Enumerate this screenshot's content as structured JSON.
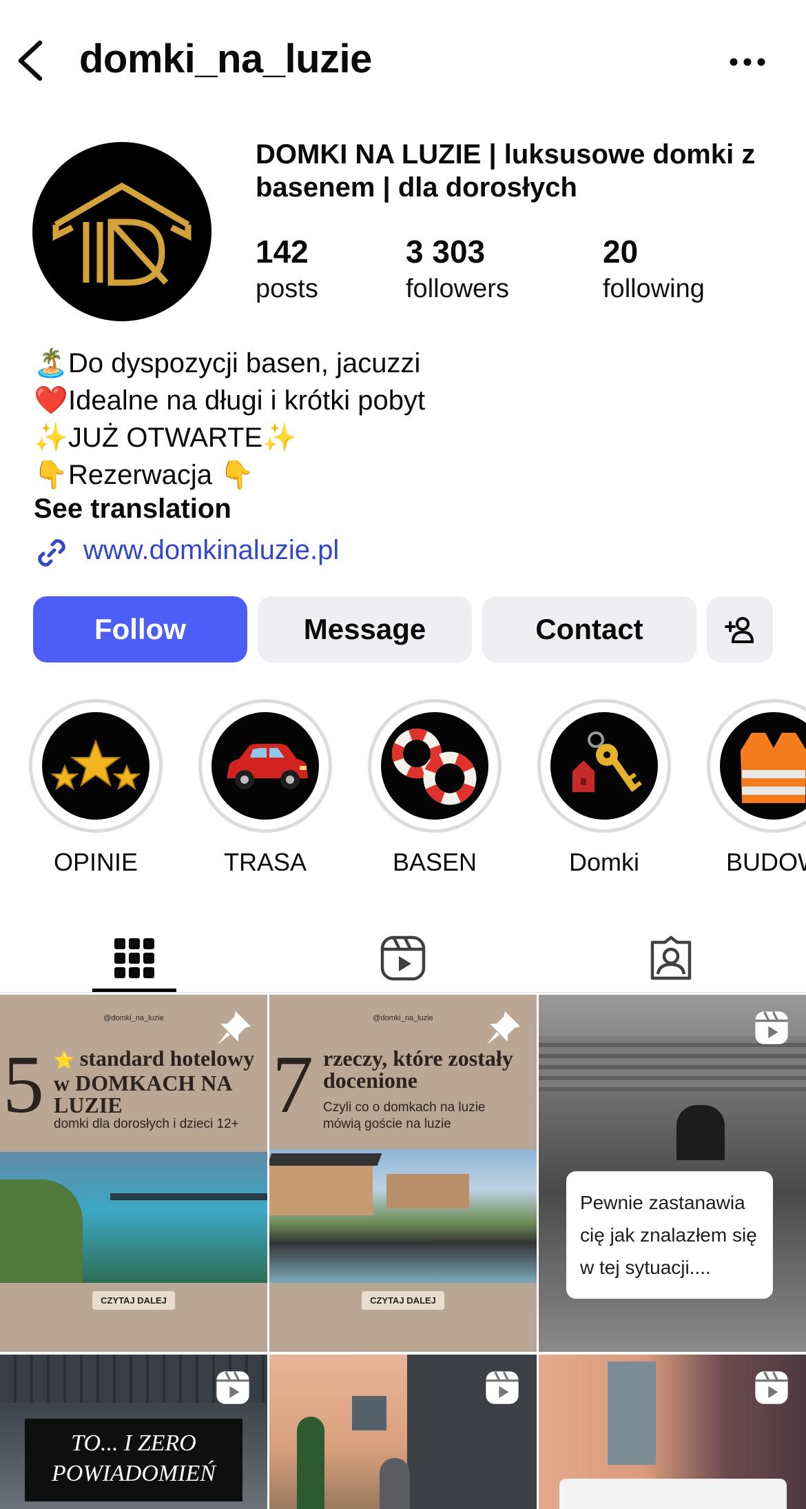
{
  "header": {
    "username": "domki_na_luzie"
  },
  "profile": {
    "full_name": "DOMKI NA LUZIE | luksusowe domki z basenem | dla dorosłych",
    "stats": [
      {
        "number": "142",
        "label": "posts"
      },
      {
        "number": "3 303",
        "label": "followers"
      },
      {
        "number": "20",
        "label": "following"
      }
    ],
    "bio": [
      {
        "emoji": "🏝️",
        "text": "Do dyspozycji basen, jacuzzi"
      },
      {
        "emoji": "❤️",
        "text": "Idealne na długi i krótki pobyt"
      },
      {
        "emoji": "✨",
        "text": "JUŻ OTWARTE",
        "emoji_after": "✨"
      },
      {
        "emoji": "👇",
        "text": "Rezerwacja ",
        "emoji_after": "👇"
      }
    ],
    "see_translation": "See translation",
    "website": "www.domkinaluzie.pl"
  },
  "actions": {
    "follow": "Follow",
    "message": "Message",
    "contact": "Contact"
  },
  "highlights": [
    {
      "label": "OPINIE",
      "icon": "stars-icon"
    },
    {
      "label": "TRASA",
      "icon": "car-icon"
    },
    {
      "label": "BASEN",
      "icon": "lifebuoy-icon"
    },
    {
      "label": "Domki",
      "icon": "house-keys-icon"
    },
    {
      "label": "BUDOW",
      "icon": "safety-vest-icon"
    }
  ],
  "tabs": [
    {
      "name": "posts-grid",
      "icon": "grid-icon",
      "active": true
    },
    {
      "name": "reels",
      "icon": "reels-icon",
      "active": false
    },
    {
      "name": "tagged",
      "icon": "tagged-icon",
      "active": false
    }
  ],
  "posts": [
    {
      "handle": "@domki_na_luzie",
      "number": "5",
      "star": "⭐",
      "headline": "standard hotelowy w DOMKACH NA LUZIE",
      "subline": "domki dla dorosłych i dzieci 12+",
      "read_more": "CZYTAJ DALEJ",
      "pinned": true
    },
    {
      "handle": "@domki_na_luzie",
      "number": "7",
      "headline": "rzeczy, które zostały docenione",
      "subline": "Czyli co o domkach na luzie mówią goście na luzie",
      "read_more": "CZYTAJ DALEJ",
      "pinned": true
    },
    {
      "caption": "Pewnie zastanawia cię jak znalazłem się w tej sytuacji....",
      "reel": true
    },
    {
      "caption": "TO... I ZERO POWIADOMIEŃ",
      "reel": true
    },
    {
      "reel": true
    },
    {
      "reel": true
    }
  ],
  "colors": {
    "follow_button": "#4c5ef6",
    "secondary_button": "#efeff3",
    "link": "#3346c7",
    "logo_gold": "#d4a23a",
    "post_beige": "#b9a695"
  }
}
